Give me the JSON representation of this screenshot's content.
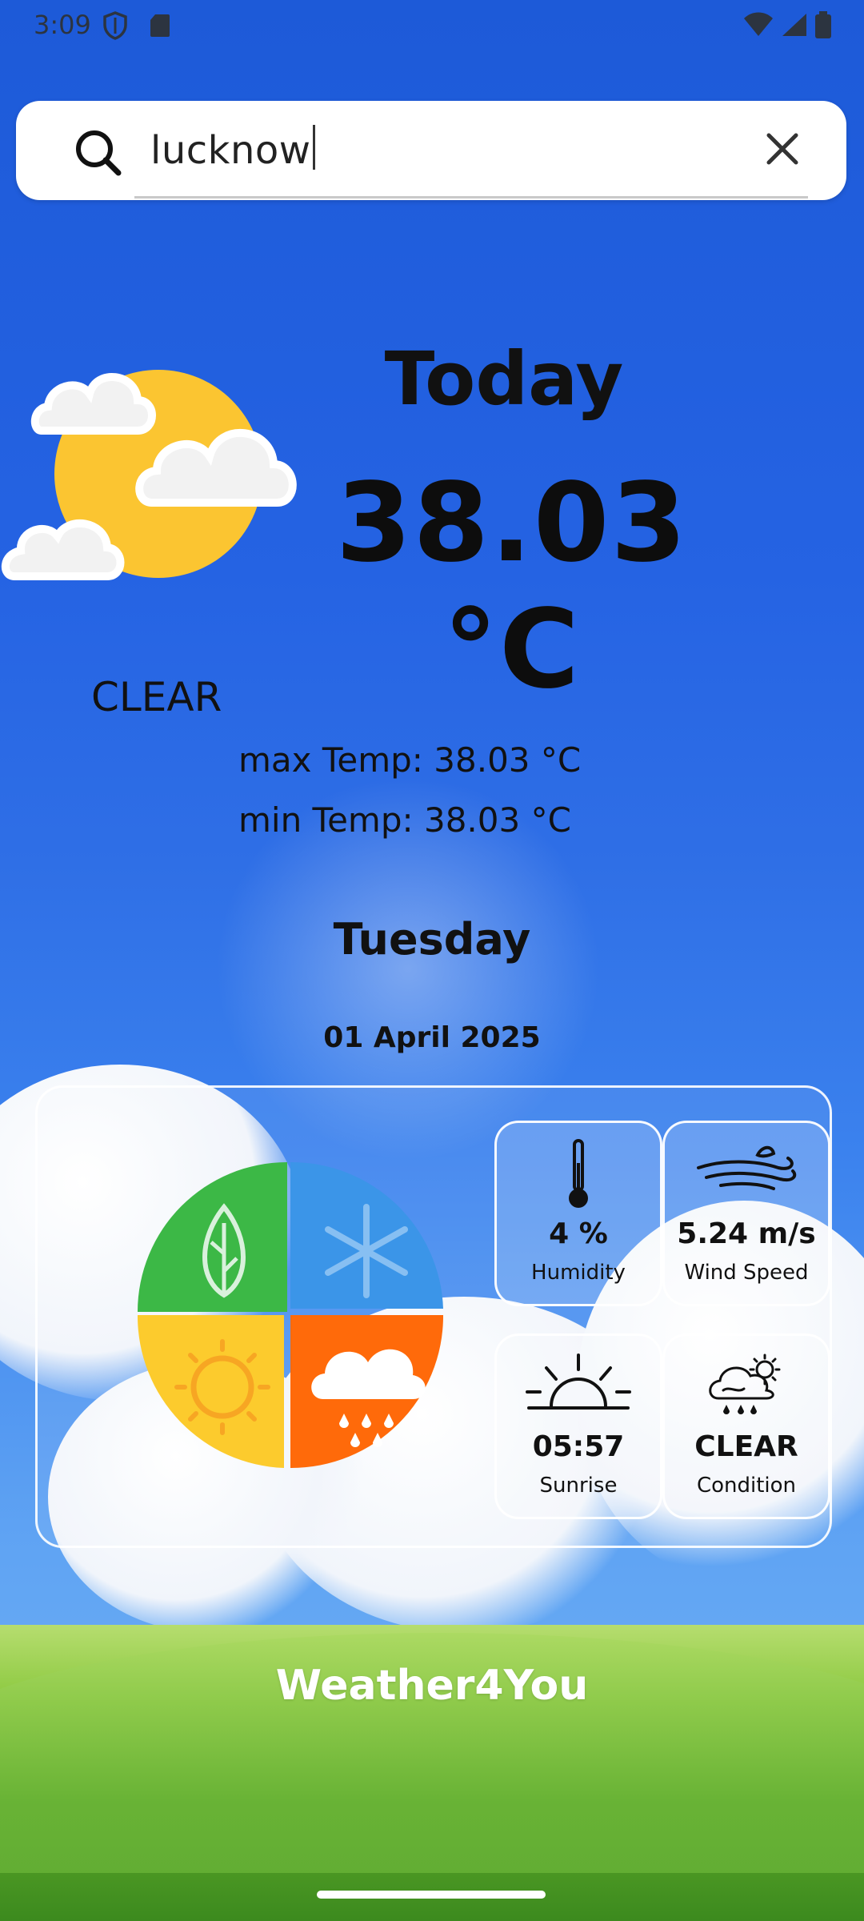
{
  "status_bar": {
    "time": "3:09"
  },
  "search": {
    "value": "lucknow"
  },
  "weather": {
    "heading": "Today",
    "temperature": "38.03 °C",
    "condition": "CLEAR",
    "max_temp": "max Temp: 38.03 °C",
    "min_temp": "min Temp: 38.03 °C",
    "day": "Tuesday",
    "date": "01 April 2025"
  },
  "tiles": {
    "humidity": {
      "value": "4 %",
      "label": "Humidity"
    },
    "wind": {
      "value": "5.24 m/s",
      "label": "Wind Speed"
    },
    "sunrise": {
      "value": "05:57",
      "label": "Sunrise"
    },
    "condition": {
      "value": "CLEAR",
      "label": "Condition"
    }
  },
  "footer": {
    "brand": "Weather4You"
  },
  "colors": {
    "sky": "#2563e3",
    "sun": "#fbc531",
    "season_green": "#3cb846",
    "season_blue": "#3b95e8",
    "season_yellow": "#fccb2d",
    "season_orange": "#ff6a0a"
  }
}
